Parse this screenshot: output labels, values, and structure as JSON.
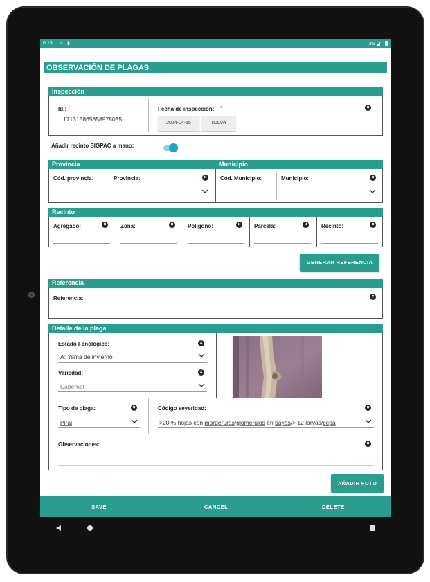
{
  "status_bar": {
    "time": "6:13",
    "network": "3G"
  },
  "page_title": "OBSERVACIÓN DE PLAGAS",
  "inspeccion": {
    "header": "Inspección",
    "id_label": "Id.:",
    "id_value": "17131586585897808​5",
    "fecha_label": "Fecha de inspección:",
    "fecha_required": "*",
    "fecha_value": "2024-04-15",
    "today_button": "TODAY"
  },
  "sigpac": {
    "label": "Añadir recinto SIGPAC a mano:",
    "enabled": true
  },
  "provincia": {
    "header": "Provincia",
    "cod_label": "Cód. provincia:",
    "name_label": "Provincia:"
  },
  "municipio": {
    "header": "Municipio",
    "cod_label": "Cód. Municipio:",
    "name_label": "Municipio:"
  },
  "recinto": {
    "header": "Recinto",
    "fields": [
      "Agregado:",
      "Zona:",
      "Polígono:",
      "Parcela:",
      "Recinto:"
    ]
  },
  "generar_button": "GENERAR REFERENCIA",
  "referencia": {
    "header": "Referencia",
    "label": "Referencia:"
  },
  "detalle": {
    "header": "Detalle de la plaga",
    "estado_label": "Estado Fenológico:",
    "estado_value": "A: Yema de invierno",
    "variedad_label": "Variedad:",
    "variedad_value": "Cabernet",
    "tipo_label": "Tipo de plaga:",
    "tipo_value": "Piral",
    "severidad_label": "Código severidad:",
    "severidad_parts": [
      ">20 % hojas con ",
      "morderuras",
      "/",
      "glomérulos",
      " en ",
      "bayas",
      "/> 12  larvas/",
      "cepa"
    ],
    "observaciones_label": "Observaciones:"
  },
  "anadir_foto_button": "AÑADIR FOTO",
  "bottom_bar": {
    "save": "SAVE",
    "cancel": "CANCEL",
    "delete": "DELETE"
  },
  "icons": {
    "clear": "clear-circle-icon",
    "dropdown": "chevron-down-icon"
  },
  "colors": {
    "accent": "#2a9d8f",
    "toggle": "#1fa4c4",
    "bezel": "#111111"
  }
}
